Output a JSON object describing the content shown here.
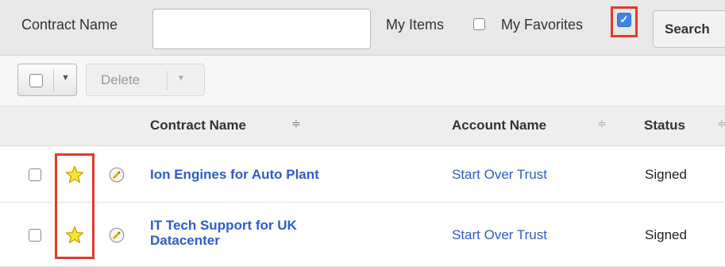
{
  "filter": {
    "contract_name_label": "Contract Name",
    "contract_name_value": "",
    "my_items_label": "My Items",
    "my_items_checked": false,
    "my_favorites_label": "My Favorites",
    "my_favorites_checked": true,
    "search_label": "Search"
  },
  "actions": {
    "delete_label": "Delete"
  },
  "table": {
    "columns": [
      {
        "label": "Contract Name",
        "sorted": true
      },
      {
        "label": "Account Name",
        "sorted": false
      },
      {
        "label": "Status",
        "sorted": false
      }
    ],
    "rows": [
      {
        "contract_name": "Ion Engines for Auto Plant",
        "account_name": "Start Over Trust",
        "status": "Signed",
        "favorite": true
      },
      {
        "contract_name_line1": "IT Tech Support for UK",
        "contract_name_line2": "Datacenter",
        "account_name": "Start Over Trust",
        "status": "Signed",
        "favorite": true
      }
    ]
  },
  "colors": {
    "link": "#2e5ccc",
    "highlight": "#e23b28",
    "checkbox_checked": "#3f86e3",
    "star_fill": "#f7e733"
  },
  "icons": {
    "favorite": "star-icon",
    "edit": "pencil-icon",
    "sort": "sort-arrows-icon",
    "dropdown": "caret-down-icon"
  }
}
